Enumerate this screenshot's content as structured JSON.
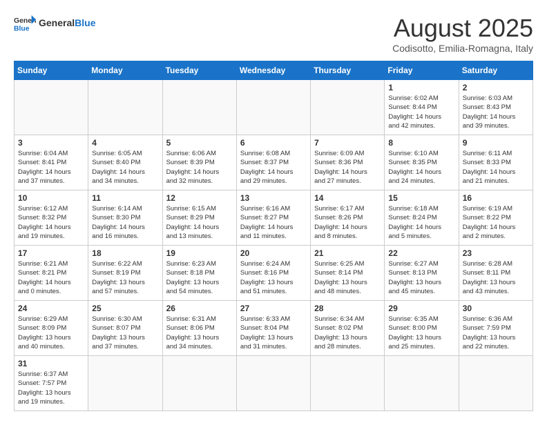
{
  "header": {
    "logo_general": "General",
    "logo_blue": "Blue",
    "month_title": "August 2025",
    "subtitle": "Codisotto, Emilia-Romagna, Italy"
  },
  "weekdays": [
    "Sunday",
    "Monday",
    "Tuesday",
    "Wednesday",
    "Thursday",
    "Friday",
    "Saturday"
  ],
  "weeks": [
    [
      {
        "day": "",
        "info": ""
      },
      {
        "day": "",
        "info": ""
      },
      {
        "day": "",
        "info": ""
      },
      {
        "day": "",
        "info": ""
      },
      {
        "day": "",
        "info": ""
      },
      {
        "day": "1",
        "info": "Sunrise: 6:02 AM\nSunset: 8:44 PM\nDaylight: 14 hours\nand 42 minutes."
      },
      {
        "day": "2",
        "info": "Sunrise: 6:03 AM\nSunset: 8:43 PM\nDaylight: 14 hours\nand 39 minutes."
      }
    ],
    [
      {
        "day": "3",
        "info": "Sunrise: 6:04 AM\nSunset: 8:41 PM\nDaylight: 14 hours\nand 37 minutes."
      },
      {
        "day": "4",
        "info": "Sunrise: 6:05 AM\nSunset: 8:40 PM\nDaylight: 14 hours\nand 34 minutes."
      },
      {
        "day": "5",
        "info": "Sunrise: 6:06 AM\nSunset: 8:39 PM\nDaylight: 14 hours\nand 32 minutes."
      },
      {
        "day": "6",
        "info": "Sunrise: 6:08 AM\nSunset: 8:37 PM\nDaylight: 14 hours\nand 29 minutes."
      },
      {
        "day": "7",
        "info": "Sunrise: 6:09 AM\nSunset: 8:36 PM\nDaylight: 14 hours\nand 27 minutes."
      },
      {
        "day": "8",
        "info": "Sunrise: 6:10 AM\nSunset: 8:35 PM\nDaylight: 14 hours\nand 24 minutes."
      },
      {
        "day": "9",
        "info": "Sunrise: 6:11 AM\nSunset: 8:33 PM\nDaylight: 14 hours\nand 21 minutes."
      }
    ],
    [
      {
        "day": "10",
        "info": "Sunrise: 6:12 AM\nSunset: 8:32 PM\nDaylight: 14 hours\nand 19 minutes."
      },
      {
        "day": "11",
        "info": "Sunrise: 6:14 AM\nSunset: 8:30 PM\nDaylight: 14 hours\nand 16 minutes."
      },
      {
        "day": "12",
        "info": "Sunrise: 6:15 AM\nSunset: 8:29 PM\nDaylight: 14 hours\nand 13 minutes."
      },
      {
        "day": "13",
        "info": "Sunrise: 6:16 AM\nSunset: 8:27 PM\nDaylight: 14 hours\nand 11 minutes."
      },
      {
        "day": "14",
        "info": "Sunrise: 6:17 AM\nSunset: 8:26 PM\nDaylight: 14 hours\nand 8 minutes."
      },
      {
        "day": "15",
        "info": "Sunrise: 6:18 AM\nSunset: 8:24 PM\nDaylight: 14 hours\nand 5 minutes."
      },
      {
        "day": "16",
        "info": "Sunrise: 6:19 AM\nSunset: 8:22 PM\nDaylight: 14 hours\nand 2 minutes."
      }
    ],
    [
      {
        "day": "17",
        "info": "Sunrise: 6:21 AM\nSunset: 8:21 PM\nDaylight: 14 hours\nand 0 minutes."
      },
      {
        "day": "18",
        "info": "Sunrise: 6:22 AM\nSunset: 8:19 PM\nDaylight: 13 hours\nand 57 minutes."
      },
      {
        "day": "19",
        "info": "Sunrise: 6:23 AM\nSunset: 8:18 PM\nDaylight: 13 hours\nand 54 minutes."
      },
      {
        "day": "20",
        "info": "Sunrise: 6:24 AM\nSunset: 8:16 PM\nDaylight: 13 hours\nand 51 minutes."
      },
      {
        "day": "21",
        "info": "Sunrise: 6:25 AM\nSunset: 8:14 PM\nDaylight: 13 hours\nand 48 minutes."
      },
      {
        "day": "22",
        "info": "Sunrise: 6:27 AM\nSunset: 8:13 PM\nDaylight: 13 hours\nand 45 minutes."
      },
      {
        "day": "23",
        "info": "Sunrise: 6:28 AM\nSunset: 8:11 PM\nDaylight: 13 hours\nand 43 minutes."
      }
    ],
    [
      {
        "day": "24",
        "info": "Sunrise: 6:29 AM\nSunset: 8:09 PM\nDaylight: 13 hours\nand 40 minutes."
      },
      {
        "day": "25",
        "info": "Sunrise: 6:30 AM\nSunset: 8:07 PM\nDaylight: 13 hours\nand 37 minutes."
      },
      {
        "day": "26",
        "info": "Sunrise: 6:31 AM\nSunset: 8:06 PM\nDaylight: 13 hours\nand 34 minutes."
      },
      {
        "day": "27",
        "info": "Sunrise: 6:33 AM\nSunset: 8:04 PM\nDaylight: 13 hours\nand 31 minutes."
      },
      {
        "day": "28",
        "info": "Sunrise: 6:34 AM\nSunset: 8:02 PM\nDaylight: 13 hours\nand 28 minutes."
      },
      {
        "day": "29",
        "info": "Sunrise: 6:35 AM\nSunset: 8:00 PM\nDaylight: 13 hours\nand 25 minutes."
      },
      {
        "day": "30",
        "info": "Sunrise: 6:36 AM\nSunset: 7:59 PM\nDaylight: 13 hours\nand 22 minutes."
      }
    ],
    [
      {
        "day": "31",
        "info": "Sunrise: 6:37 AM\nSunset: 7:57 PM\nDaylight: 13 hours\nand 19 minutes."
      },
      {
        "day": "",
        "info": ""
      },
      {
        "day": "",
        "info": ""
      },
      {
        "day": "",
        "info": ""
      },
      {
        "day": "",
        "info": ""
      },
      {
        "day": "",
        "info": ""
      },
      {
        "day": "",
        "info": ""
      }
    ]
  ]
}
